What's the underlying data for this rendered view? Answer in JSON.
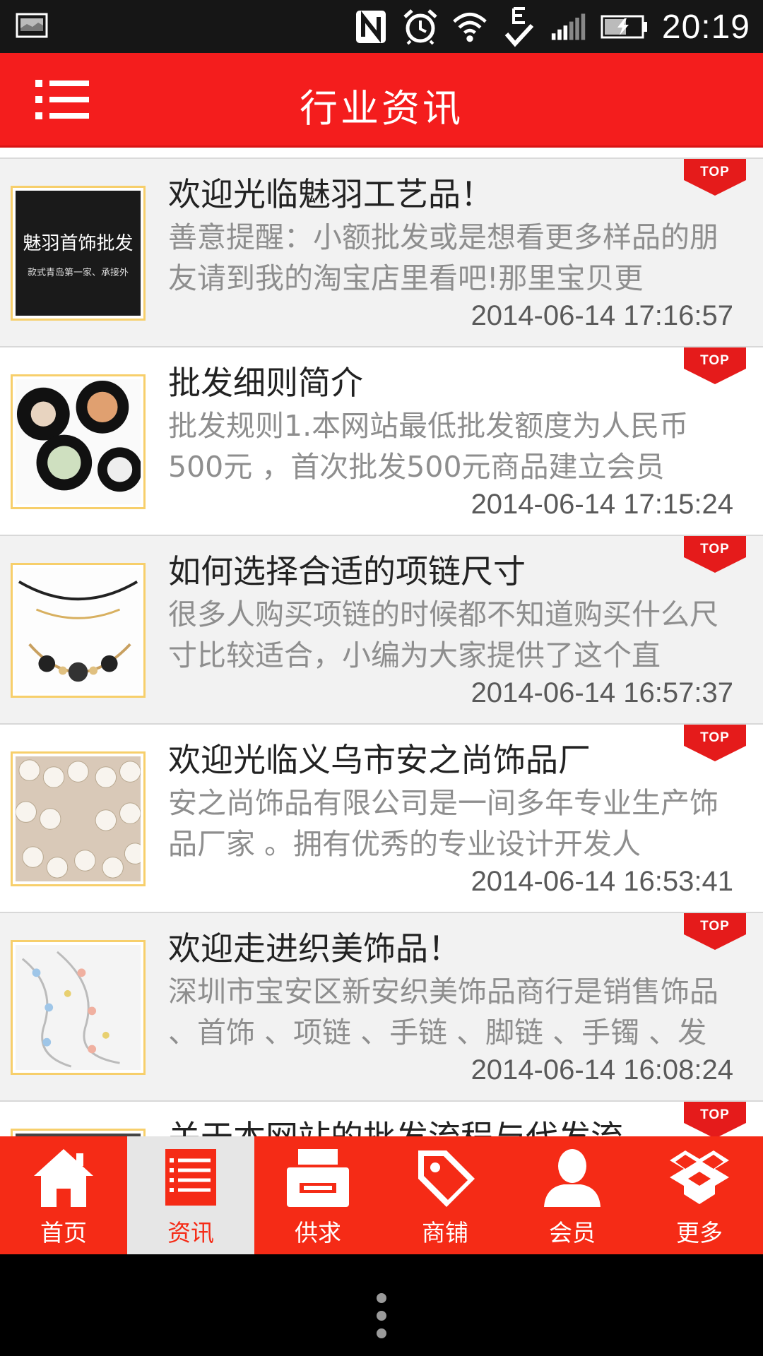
{
  "status_bar": {
    "time": "20:19",
    "icons": [
      "screenshot-icon",
      "nfc-icon",
      "alarm-icon",
      "wifi-icon",
      "edge-data-icon",
      "signal-icon",
      "battery-charging-icon"
    ]
  },
  "header": {
    "title": "行业资讯",
    "menu_icon": "list-menu-icon"
  },
  "colors": {
    "brand_red": "#f41d1d",
    "tab_red": "#f52b16",
    "thumb_border": "#f7cf6b"
  },
  "news": [
    {
      "title": "欢迎光临魅羽工艺品！",
      "desc": "善意提醒：小额批发或是想看更多样品的朋友请到我的淘宝店里看吧!那里宝贝更",
      "date": "2014-06-14 17:16:57",
      "badge": "TOP",
      "thumb_text_1": "魅羽首饰批发",
      "thumb_text_2": "款式青岛第一家、承接外"
    },
    {
      "title": "批发细则简介",
      "desc": "批发规则1.本网站最低批发额度为人民币500元 ，首次批发500元商品建立会员",
      "date": "2014-06-14 17:15:24",
      "badge": "TOP"
    },
    {
      "title": "如何选择合适的项链尺寸",
      "desc": "很多人购买项链的时候都不知道购买什么尺寸比较适合，小编为大家提供了这个直",
      "date": "2014-06-14 16:57:37",
      "badge": "TOP"
    },
    {
      "title": "欢迎光临义乌市安之尚饰品厂",
      "desc": "安之尚饰品有限公司是一间多年专业生产饰品厂家 。拥有优秀的专业设计开发人",
      "date": "2014-06-14 16:53:41",
      "badge": "TOP"
    },
    {
      "title": "欢迎走进织美饰品！",
      "desc": "深圳市宝安区新安织美饰品商行是销售饰品 、首饰 、项链 、手链 、脚链 、手镯 、发",
      "date": "2014-06-14 16:08:24",
      "badge": "TOP"
    },
    {
      "title": "关于本网站的批发流程与代发流",
      "desc": "",
      "date": "",
      "badge": "TOP"
    }
  ],
  "tabs": [
    {
      "label": "首页",
      "icon": "home-icon",
      "active": false
    },
    {
      "label": "资讯",
      "icon": "news-list-icon",
      "active": true
    },
    {
      "label": "供求",
      "icon": "printer-icon",
      "active": false
    },
    {
      "label": "商铺",
      "icon": "tag-icon",
      "active": false
    },
    {
      "label": "会员",
      "icon": "user-icon",
      "active": false
    },
    {
      "label": "更多",
      "icon": "boxes-icon",
      "active": false
    }
  ],
  "nav": {
    "icon": "menu-dots-icon"
  }
}
